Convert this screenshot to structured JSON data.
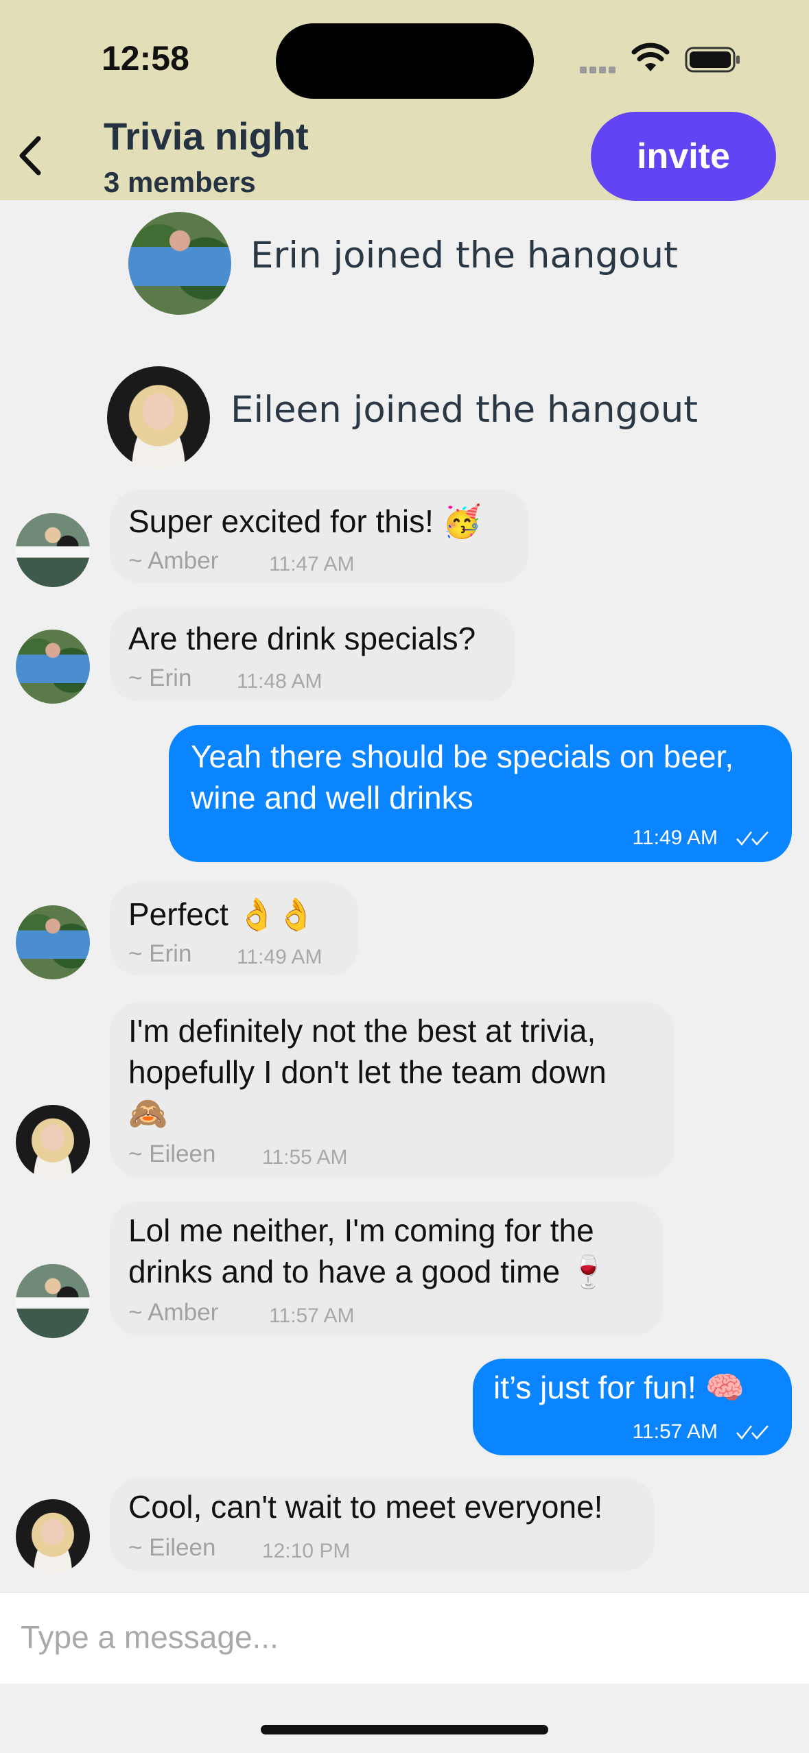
{
  "status_bar": {
    "time": "12:58"
  },
  "header": {
    "title": "Trivia night",
    "subtitle": "3 members",
    "invite_label": "invite",
    "back_icon": "chevron-left-icon"
  },
  "events": [
    {
      "text": "Erin joined the hangout",
      "avatar": "erin"
    },
    {
      "text": "Eileen joined the hangout",
      "avatar": "eileen"
    }
  ],
  "messages": [
    {
      "direction": "in",
      "lines": [
        "Super excited for this! 🥳"
      ],
      "sender": "~ Amber",
      "time": "11:47 AM",
      "avatar": "amber"
    },
    {
      "direction": "in",
      "lines": [
        "Are there drink specials?"
      ],
      "sender": "~ Erin",
      "time": "11:48 AM",
      "avatar": "erin"
    },
    {
      "direction": "out",
      "lines": [
        "Yeah there should be specials on beer,",
        "wine and well drinks"
      ],
      "time": "11:49 AM",
      "status": "✓✓"
    },
    {
      "direction": "in",
      "lines": [
        "Perfect 👌👌"
      ],
      "sender": "~ Erin",
      "time": "11:49 AM",
      "avatar": "erin"
    },
    {
      "direction": "in",
      "lines": [
        "I'm definitely not the best at trivia,",
        "hopefully I don't let the team down",
        "🙈"
      ],
      "sender": "~ Eileen",
      "time": "11:55 AM",
      "avatar": "eileen"
    },
    {
      "direction": "in",
      "lines": [
        "Lol me neither, I'm coming for the",
        "drinks and to have a good time 🍷"
      ],
      "sender": "~ Amber",
      "time": "11:57 AM",
      "avatar": "amber"
    },
    {
      "direction": "out",
      "lines": [
        "it’s just for fun! 🧠"
      ],
      "time": "11:57 AM",
      "status": "✓✓"
    },
    {
      "direction": "in",
      "lines": [
        "Cool, can't wait to meet everyone!"
      ],
      "sender": "~ Eileen",
      "time": "12:10 PM",
      "avatar": "eileen"
    }
  ],
  "composer": {
    "placeholder": "Type a message..."
  },
  "colors": {
    "header_bg": "#e2dfb8",
    "invite_bg": "#6244f5",
    "outgoing_bubble": "#0a84ff",
    "incoming_bubble": "#ebebeb"
  }
}
